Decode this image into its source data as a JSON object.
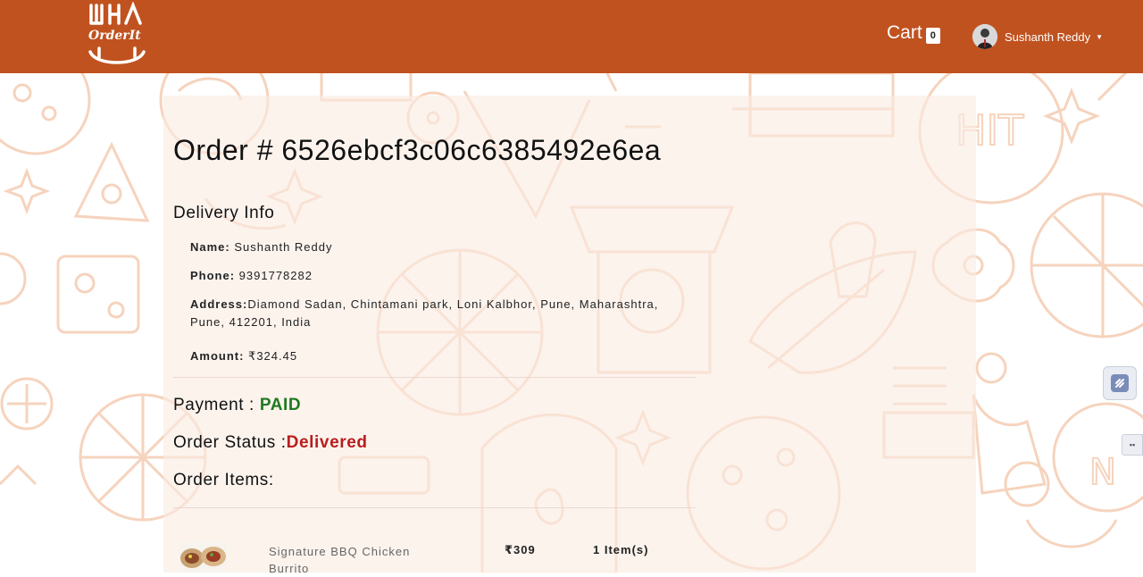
{
  "header": {
    "logo_text": "OrderIt",
    "cart_label": "Cart",
    "cart_count": "0",
    "user_name": "Sushanth Reddy"
  },
  "order": {
    "title": "Order # 6526ebcf3c06c6385492e6ea",
    "delivery_heading": "Delivery Info",
    "name_label": "Name:",
    "name_value": " Sushanth Reddy",
    "phone_label": "Phone:",
    "phone_value": " 9391778282",
    "address_label": "Address:",
    "address_line1": "Diamond Sadan, Chintamani park, Loni Kalbhor, Pune, Maharashtra,",
    "address_line2": "Pune, 412201, India",
    "amount_label": "Amount:",
    "amount_value": " ₹324.45",
    "payment_label": "Payment : ",
    "payment_value": "PAID",
    "status_label": "Order Status :",
    "status_value": "Delivered",
    "items_heading": "Order Items:"
  },
  "items": [
    {
      "name": "Signature BBQ Chicken Burrito",
      "price": "₹309",
      "quantity": "1 Item(s)"
    }
  ],
  "colors": {
    "header_bg": "#c0521f",
    "paid": "#1f7a1f",
    "delivered": "#b81e1e",
    "pattern": "#f6d4bf"
  }
}
